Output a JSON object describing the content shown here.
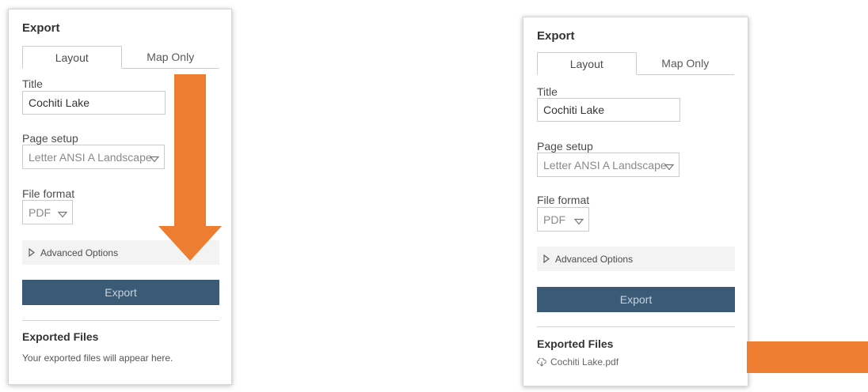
{
  "colors": {
    "accent_arrow": "#ed7d31",
    "export_button_bg": "#3b5a75",
    "advanced_bg": "#f3f3f3"
  },
  "panel_before": {
    "heading": "Export",
    "tabs": [
      {
        "label": "Layout",
        "active": true
      },
      {
        "label": "Map Only",
        "active": false
      }
    ],
    "title_label": "Title",
    "title_value": "Cochiti Lake",
    "page_setup_label": "Page setup",
    "page_setup_value": "Letter ANSI A Landscape",
    "file_format_label": "File format",
    "file_format_value": "PDF",
    "advanced_label": "Advanced Options",
    "advanced_icon": "caret-right-icon",
    "export_button": "Export",
    "exported_heading": "Exported Files",
    "exported_empty": "Your exported files will appear here."
  },
  "panel_after": {
    "heading": "Export",
    "tabs": [
      {
        "label": "Layout",
        "active": true
      },
      {
        "label": "Map Only",
        "active": false
      }
    ],
    "title_label": "Title",
    "title_value": "Cochiti Lake",
    "page_setup_label": "Page setup",
    "page_setup_value": "Letter ANSI A Landscape",
    "file_format_label": "File format",
    "file_format_value": "PDF",
    "advanced_label": "Advanced Options",
    "advanced_icon": "caret-right-icon",
    "export_button": "Export",
    "exported_heading": "Exported Files",
    "exported_file": "Cochiti Lake.pdf",
    "exported_file_icon": "download-icon"
  }
}
